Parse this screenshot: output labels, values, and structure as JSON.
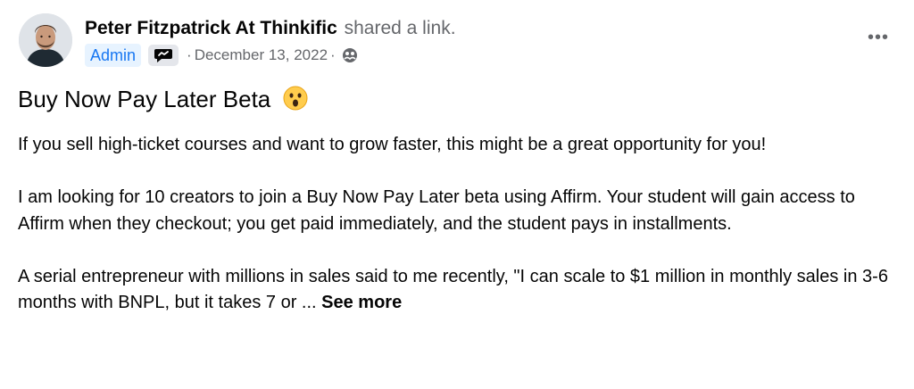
{
  "post": {
    "author_name": "Peter Fitzpatrick At Thinkific",
    "action_text": "shared a link.",
    "role_badge": "Admin",
    "date": "December 13, 2022",
    "separator": "·",
    "more_label": "•••",
    "title": "Buy Now Pay Later Beta",
    "paragraphs": [
      "If you sell high-ticket courses and want to grow faster, this might be a great opportunity for you!",
      "I am looking for 10 creators to join a Buy Now Pay Later beta using Affirm. Your student will gain access to Affirm when they checkout; you get paid immediately, and the student pays in installments.",
      "A serial entrepreneur with millions in sales said to me recently, \"I can scale to $1 million in monthly sales in 3-6 months with BNPL, but it takes 7 or ..."
    ],
    "see_more_label": "See more"
  },
  "icons": {
    "avatar": "profile-photo",
    "group_badge": "speech-bubble-badge-icon",
    "audience": "group-members-icon",
    "emoji": "astonished-face-emoji"
  },
  "colors": {
    "admin_badge_bg": "#e7f3ff",
    "admin_badge_text": "#1877f2",
    "secondary_text": "#65676b",
    "primary_text": "#050505"
  }
}
